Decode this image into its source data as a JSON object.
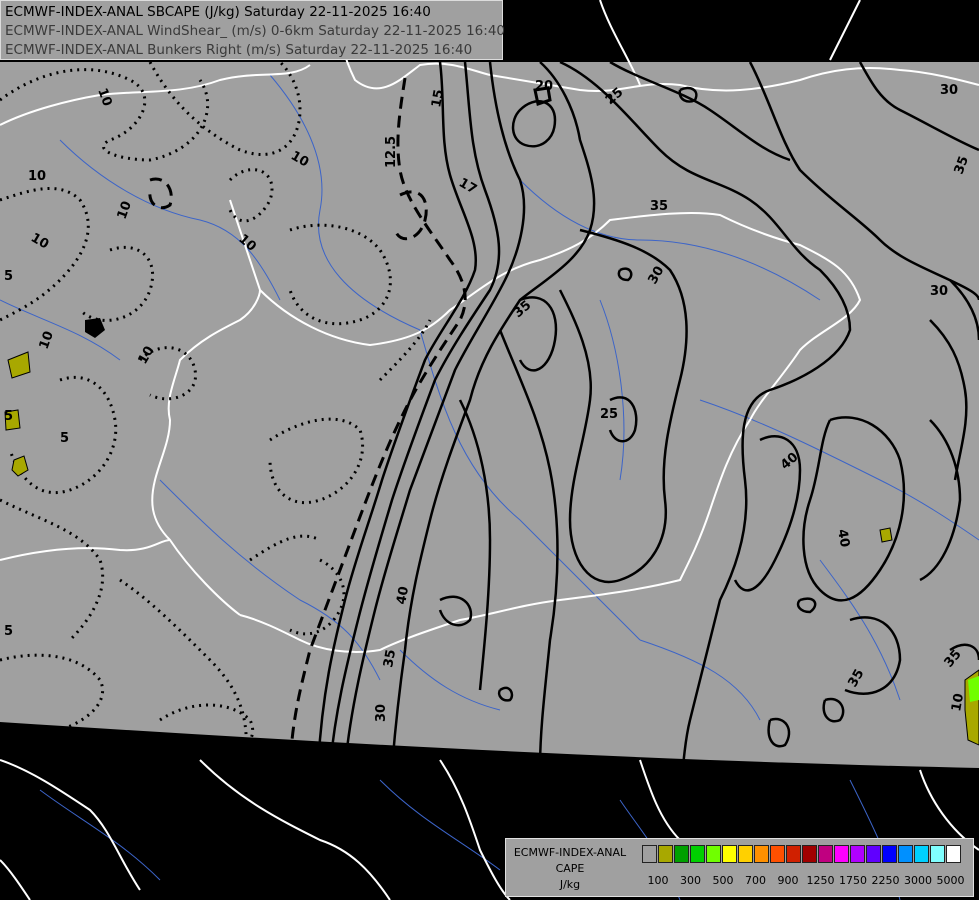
{
  "header": {
    "line1": "ECMWF-INDEX-ANAL SBCAPE (J/kg) Saturday 22-11-2025 16:40",
    "line2": "ECMWF-INDEX-ANAL WindShear_ (m/s) 0-6km Saturday 22-11-2025 16:40",
    "line3": "ECMWF-INDEX-ANAL Bunkers Right (m/s) Saturday 22-11-2025 16:40"
  },
  "contour_labels": {
    "shear": [
      "10",
      "10",
      "10",
      "10",
      "10",
      "10",
      "10",
      "5",
      "5",
      "5",
      "5",
      "10",
      "5",
      "10",
      "12.5",
      "15",
      "17",
      "20"
    ],
    "bunkers": [
      "25",
      "30",
      "35",
      "35",
      "30",
      "30",
      "25",
      "35",
      "40",
      "40",
      "40",
      "35",
      "35",
      "30",
      "35",
      "10"
    ]
  },
  "legend": {
    "title_line1": "ECMWF-INDEX-ANAL",
    "title_line2": "CAPE",
    "title_line3": "J/kg",
    "colors": [
      "#a0a0a0",
      "#a8a800",
      "#00a000",
      "#00d000",
      "#70ff00",
      "#ffff00",
      "#ffd000",
      "#ff9000",
      "#ff5000",
      "#d02000",
      "#a00000",
      "#c00080",
      "#ff00ff",
      "#b000ff",
      "#6000ff",
      "#0000ff",
      "#0090ff",
      "#00d0ff",
      "#80ffff",
      "#ffffff"
    ],
    "ticks": [
      "100",
      "300",
      "500",
      "700",
      "900",
      "1250",
      "1750",
      "2250",
      "3000",
      "5000"
    ]
  },
  "colors": {
    "map_fill": "#a0a0a0",
    "background": "#000000",
    "borders": "#ffffff",
    "rivers": "#3c64c8",
    "cape_low": "#a8a800"
  }
}
